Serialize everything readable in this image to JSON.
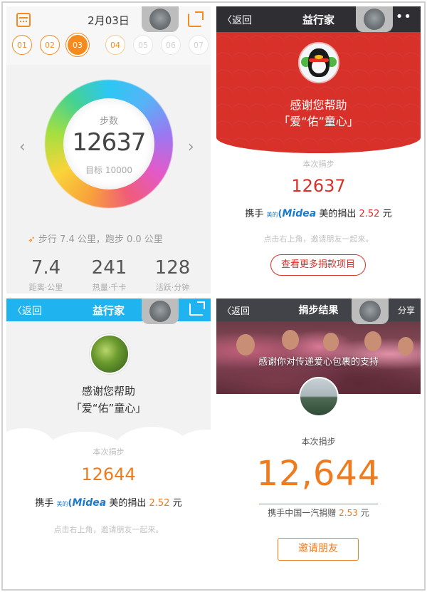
{
  "panel1": {
    "date": "2月03日",
    "days": [
      "01",
      "02",
      "03",
      "04",
      "05",
      "06",
      "07"
    ],
    "ring": {
      "title": "步数",
      "value": "12637",
      "goal": "目标 10000"
    },
    "walk_summary": "步行 7.4 公里，跑步 0.0 公里",
    "stats": [
      {
        "value": "7.4",
        "label": "距离·公里"
      },
      {
        "value": "241",
        "label": "热量·千卡"
      },
      {
        "value": "128",
        "label": "活跃·分钟"
      }
    ]
  },
  "panel2": {
    "nav": {
      "back": "返回",
      "title": "益行家",
      "more": "•••"
    },
    "thanks_line1": "感谢您帮助",
    "thanks_line2": "「爱“佑”童心」",
    "donate_label": "本次捐步",
    "donate_steps": "12637",
    "sponsor": {
      "prefix": "携手",
      "small_brand": "美的",
      "brand_arc": "(",
      "brand": "Midea",
      "text": "美的捐出",
      "amount": "2.52",
      "unit": "元"
    },
    "invite_tip": "点击右上角，邀请朋友一起来。",
    "more_button": "查看更多捐款项目",
    "accent": "#d7312a"
  },
  "panel3": {
    "nav": {
      "back": "返回",
      "title": "益行家"
    },
    "thanks_line1": "感谢您帮助",
    "thanks_line2": "「爱“佑”童心」",
    "donate_label": "本次捐步",
    "donate_steps": "12644",
    "sponsor": {
      "prefix": "携手",
      "small_brand": "美的",
      "brand_arc": "(",
      "brand": "Midea",
      "text": "美的捐出",
      "amount": "2.52",
      "unit": "元"
    },
    "invite_tip": "点击右上角，邀请朋友一起来。",
    "accent": "#1fb4f0"
  },
  "panel4": {
    "nav": {
      "back": "返回",
      "title": "捐步结果",
      "share": "分享"
    },
    "photo_caption": "感谢你对传递爱心包裹的支持",
    "donate_label": "本次捐步",
    "donate_steps": "12,644",
    "sponsor_line": {
      "text": "携手中国一汽捐赠",
      "amount": "2.53",
      "unit": "元"
    },
    "invite_button": "邀请朋友",
    "accent": "#f07a1e"
  }
}
